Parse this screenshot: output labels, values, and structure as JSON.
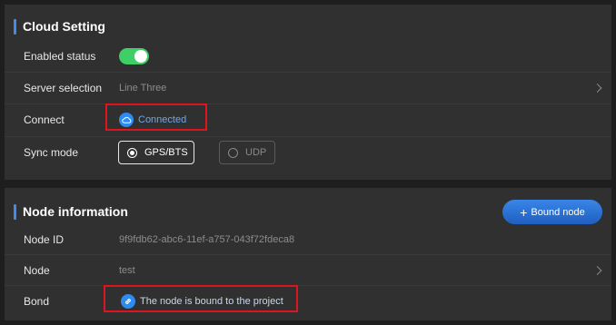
{
  "cloud_setting": {
    "title": "Cloud Setting",
    "enabled_status": {
      "label": "Enabled status",
      "value": true
    },
    "server_selection": {
      "label": "Server selection",
      "value": "Line Three"
    },
    "connect": {
      "label": "Connect",
      "value": "Connected"
    },
    "sync_mode": {
      "label": "Sync mode",
      "options": [
        "GPS/BTS",
        "UDP"
      ],
      "selected": "GPS/BTS"
    }
  },
  "node_information": {
    "title": "Node information",
    "bound_button": "Bound node",
    "node_id": {
      "label": "Node ID",
      "value": "9f9fdb62-abc6-11ef-a757-043f72fdeca8"
    },
    "node": {
      "label": "Node",
      "value": "test"
    },
    "bond": {
      "label": "Bond",
      "value": "The node is bound to the project"
    }
  },
  "colors": {
    "accent": "#3f8cf0",
    "toggle_on": "#3ecf67",
    "highlight_box": "#e0141f",
    "panel": "#303030"
  },
  "icons": {
    "connect": "cloud-icon",
    "bond": "link-icon",
    "server_chevron": "chevron-right-icon",
    "node_chevron": "chevron-right-icon"
  }
}
